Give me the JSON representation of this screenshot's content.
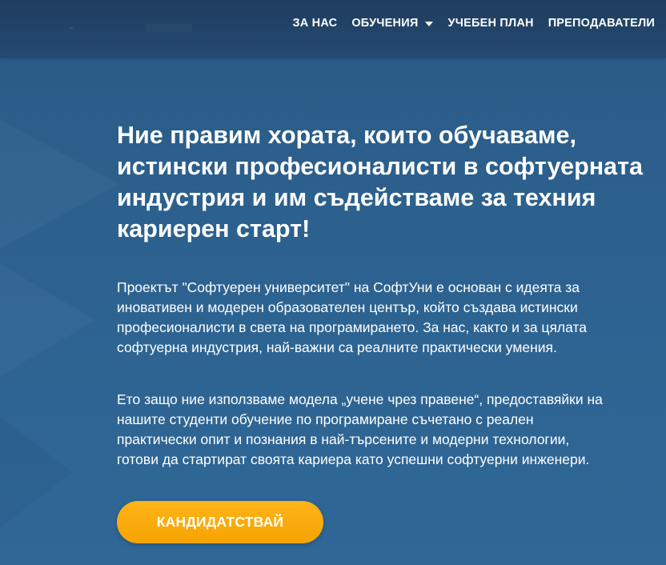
{
  "navbar": {
    "items": [
      {
        "label": "ЗА НАС"
      },
      {
        "label": "ОБУЧЕНИЯ",
        "has_dropdown": true
      },
      {
        "label": "УЧЕБЕН ПЛАН"
      },
      {
        "label": "ПРЕПОДАВАТЕЛИ"
      }
    ]
  },
  "hero": {
    "headline_lines": [
      "Ние правим хората, които обучаваме,",
      "истински професионалисти в софтуерната",
      "индустрия и им съдействаме за техния",
      "кариерен старт!"
    ],
    "paragraph1_lines": [
      "Проектът \"Софтуерен университет\" на СофтУни е основан с идеята за",
      "иновативен и модерен образователен център, който създава истински",
      "професионалисти в света на програмирането. За нас, както и за цялата",
      "софтуерна индустрия, най-важни са реалните практически умения."
    ],
    "paragraph2_lines": [
      "Ето защо ние използваме модела „учене чрез правене“, предоставяйки на",
      "нашите студенти обучение по програмиране съчетано с реален",
      "практически опит и познания в най-търсените и модерни технологии,",
      "готови да стартират своята кариера като успешни софтуерни инженери."
    ],
    "cta_label": "КАНДИДАТСТВАЙ"
  },
  "colors": {
    "navbar_bg": "#213f60",
    "hero_bg": "#2d6190",
    "text": "#ffffff",
    "cta": "#f9a80a"
  }
}
